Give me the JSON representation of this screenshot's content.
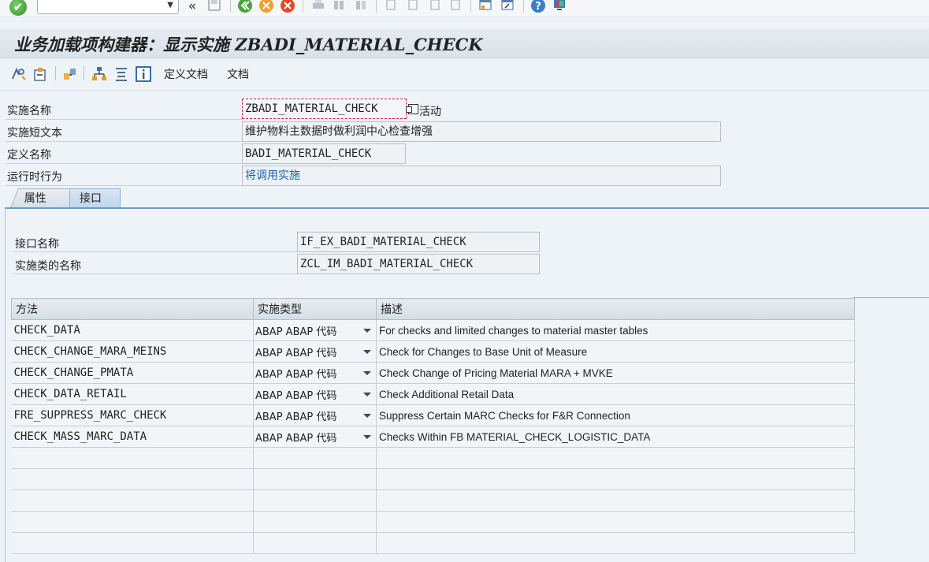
{
  "system_toolbar": {
    "ok_label": "✔",
    "command_field_value": "",
    "back_chevrons": "«",
    "dropdown_glyph": "▼"
  },
  "title_bar": {
    "title": "业务加载项构建器：显示实施 ZBADI_MATERIAL_CHECK"
  },
  "app_toolbar": {
    "definition_docs_label": "定义文档",
    "docs_label": "文档"
  },
  "header": {
    "impl_name_label": "实施名称",
    "impl_name_value": "ZBADI_MATERIAL_CHECK",
    "impl_status_label": "活动",
    "short_text_label": "实施短文本",
    "short_text_value": "维护物料主数据时做利润中心检查增强",
    "definition_name_label": "定义名称",
    "definition_name_value": "BADI_MATERIAL_CHECK",
    "runtime_behavior_label": "运行时行为",
    "runtime_behavior_value": "将调用实施"
  },
  "tabs": [
    {
      "label": "属性",
      "active": false
    },
    {
      "label": "接口",
      "active": true
    }
  ],
  "interface": {
    "interface_name_label": "接口名称",
    "interface_name_value": "IF_EX_BADI_MATERIAL_CHECK",
    "impl_class_label": "实施类的名称",
    "impl_class_value": "ZCL_IM_BADI_MATERIAL_CHECK"
  },
  "methods_table": {
    "columns": [
      "方法",
      "实施类型",
      "描述"
    ],
    "rows": [
      {
        "method": "CHECK_DATA",
        "impl_type": "ABAP ABAP 代码",
        "description": "For checks and limited changes to material master tables"
      },
      {
        "method": "CHECK_CHANGE_MARA_MEINS",
        "impl_type": "ABAP ABAP 代码",
        "description": "Check for Changes to Base Unit of Measure"
      },
      {
        "method": "CHECK_CHANGE_PMATA",
        "impl_type": "ABAP ABAP 代码",
        "description": "Check Change of Pricing Material MARA + MVKE"
      },
      {
        "method": "CHECK_DATA_RETAIL",
        "impl_type": "ABAP ABAP 代码",
        "description": "Check Additional Retail Data"
      },
      {
        "method": "FRE_SUPPRESS_MARC_CHECK",
        "impl_type": "ABAP ABAP 代码",
        "description": "Suppress Certain MARC Checks for F&R Connection"
      },
      {
        "method": "CHECK_MASS_MARC_DATA",
        "impl_type": "ABAP ABAP 代码",
        "description": "Checks Within FB MATERIAL_CHECK_LOGISTIC_DATA"
      }
    ]
  },
  "colors": {
    "accent_blue": "#6f9dc4",
    "link_blue": "#1a62a6",
    "background": "#eef3f7"
  }
}
